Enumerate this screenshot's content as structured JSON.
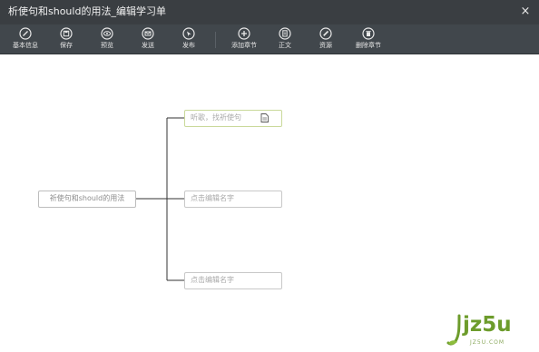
{
  "window": {
    "title": "析使句和should的用法_编辑学习单",
    "close_glyph": "×"
  },
  "toolbar": {
    "items": [
      {
        "label": "基本信息",
        "icon": "edit-pencil-icon"
      },
      {
        "label": "保存",
        "icon": "save-icon"
      },
      {
        "label": "预览",
        "icon": "eye-icon"
      },
      {
        "label": "发送",
        "icon": "send-icon"
      },
      {
        "label": "发布",
        "icon": "publish-icon"
      },
      {
        "label": "添加章节",
        "icon": "add-icon"
      },
      {
        "label": "正文",
        "icon": "document-icon"
      },
      {
        "label": "资源",
        "icon": "resource-pencil-icon"
      },
      {
        "label": "删除章节",
        "icon": "trash-icon"
      }
    ]
  },
  "mindmap": {
    "root": {
      "label": "祈使句和should的用法"
    },
    "children": [
      {
        "label": "听歌，找祈使句",
        "has_document": true
      },
      {
        "label": "点击编辑名字",
        "has_document": false
      },
      {
        "label": "点击编辑名字",
        "has_document": false
      }
    ]
  },
  "watermark": {
    "text": "jz5u",
    "subtext": "JZ5U.COM"
  },
  "colors": {
    "titlebar": "#3a3e42",
    "toolbar": "#41474c",
    "active_node_border": "#c9d99a",
    "logo_green": "#6d9c2c"
  }
}
